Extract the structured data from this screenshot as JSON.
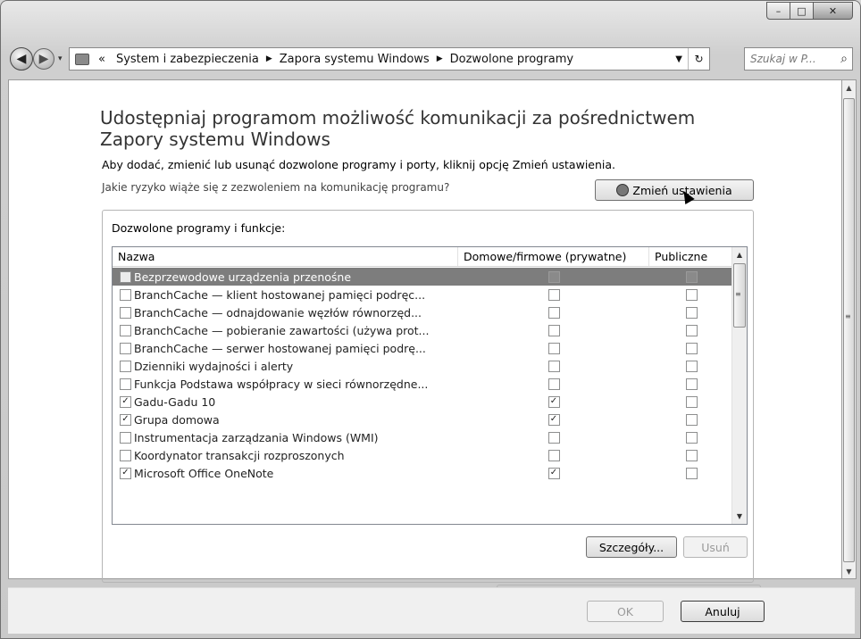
{
  "nav": {
    "back": "◀",
    "forward": "▶",
    "dropdown": "▾",
    "overflow": "«",
    "crumbs": [
      "System i zabezpieczenia",
      "Zapora systemu Windows",
      "Dozwolone programy"
    ],
    "separator": "▶",
    "address_chevron": "▼",
    "refresh": "↻",
    "search_placeholder": "Szukaj w P...",
    "search_icon": "⌕"
  },
  "window_controls": {
    "minimize": "–",
    "maximize": "□",
    "close": "✕"
  },
  "main": {
    "title": "Udostępniaj programom możliwość komunikacji za pośrednictwem Zapory systemu Windows",
    "subtitle": "Aby dodać, zmienić lub usunąć dozwolone programy i porty, kliknij opcję Zmień ustawienia.",
    "risk_link": "Jakie ryzyko wiąże się z zezwoleniem na komunikację programu?",
    "change_settings": "Zmień ustawienia",
    "group_label": "Dozwolone programy i funkcje:",
    "columns": [
      "Nazwa",
      "Domowe/firmowe (prywatne)",
      "Publiczne"
    ],
    "rows": [
      {
        "name": "Bezprzewodowe urządzenia przenośne",
        "enabled": false,
        "private": false,
        "public": false,
        "selected": true
      },
      {
        "name": "BranchCache — klient hostowanej pamięci podręc...",
        "enabled": false,
        "private": false,
        "public": false,
        "selected": false
      },
      {
        "name": "BranchCache — odnajdowanie węzłów równorzęd...",
        "enabled": false,
        "private": false,
        "public": false,
        "selected": false
      },
      {
        "name": "BranchCache — pobieranie zawartości (używa prot...",
        "enabled": false,
        "private": false,
        "public": false,
        "selected": false
      },
      {
        "name": "BranchCache — serwer hostowanej pamięci podrę...",
        "enabled": false,
        "private": false,
        "public": false,
        "selected": false
      },
      {
        "name": "Dzienniki wydajności i alerty",
        "enabled": false,
        "private": false,
        "public": false,
        "selected": false
      },
      {
        "name": "Funkcja Podstawa współpracy w sieci równorzędne...",
        "enabled": false,
        "private": false,
        "public": false,
        "selected": false
      },
      {
        "name": "Gadu-Gadu 10",
        "enabled": true,
        "private": true,
        "public": false,
        "selected": false
      },
      {
        "name": "Grupa domowa",
        "enabled": true,
        "private": true,
        "public": false,
        "selected": false
      },
      {
        "name": "Instrumentacja zarządzania Windows (WMI)",
        "enabled": false,
        "private": false,
        "public": false,
        "selected": false
      },
      {
        "name": "Koordynator transakcji rozproszonych",
        "enabled": false,
        "private": false,
        "public": false,
        "selected": false
      },
      {
        "name": "Microsoft Office OneNote",
        "enabled": true,
        "private": true,
        "public": false,
        "selected": false
      }
    ],
    "details_button": "Szczegóły...",
    "remove_button": "Usuń",
    "check_mark": "✓",
    "scroll_up": "▲",
    "scroll_down": "▼",
    "grip": "≡"
  },
  "footer": {
    "ok": "OK",
    "cancel": "Anuluj"
  }
}
